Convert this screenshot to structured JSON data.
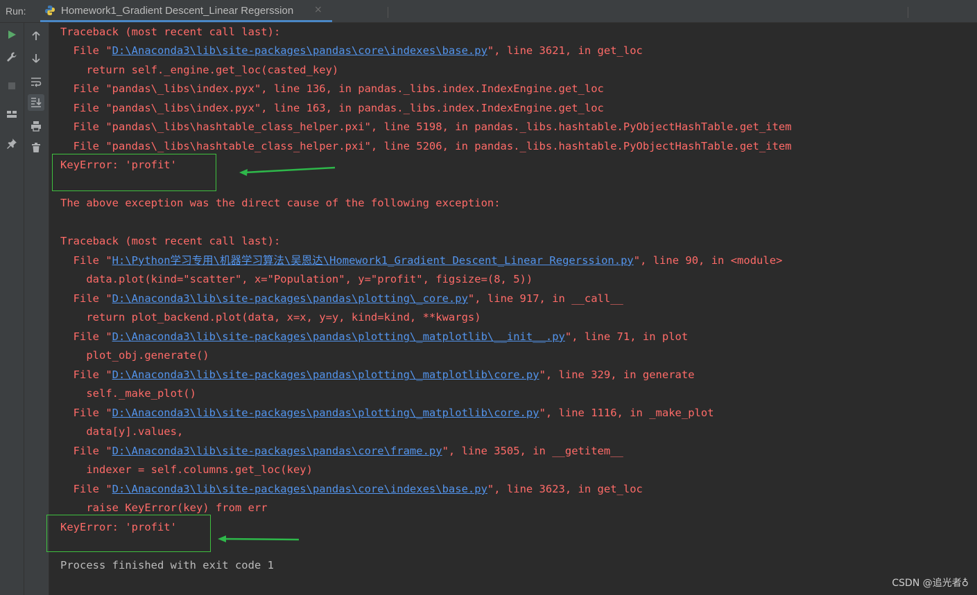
{
  "header": {
    "run_label": "Run:",
    "tab_title": "Homework1_Gradient Descent_Linear Regerssion",
    "close_glyph": "×"
  },
  "console": {
    "tb1": {
      "line": "Traceback (most recent call last):"
    },
    "f1": {
      "pre": "  File \"",
      "link": "D:\\Anaconda3\\lib\\site-packages\\pandas\\core\\indexes\\base.py",
      "post": "\", line 3621, in get_loc"
    },
    "c1": "    return self._engine.get_loc(casted_key)",
    "f2": "  File \"pandas\\_libs\\index.pyx\", line 136, in pandas._libs.index.IndexEngine.get_loc",
    "f3": "  File \"pandas\\_libs\\index.pyx\", line 163, in pandas._libs.index.IndexEngine.get_loc",
    "f4": "  File \"pandas\\_libs\\hashtable_class_helper.pxi\", line 5198, in pandas._libs.hashtable.PyObjectHashTable.get_item",
    "f5": "  File \"pandas\\_libs\\hashtable_class_helper.pxi\", line 5206, in pandas._libs.hashtable.PyObjectHashTable.get_item",
    "err1": "KeyError: 'profit'",
    "cause": "The above exception was the direct cause of the following exception:",
    "tb2": {
      "line": "Traceback (most recent call last):"
    },
    "g1": {
      "pre": "  File \"",
      "link": "H:\\Python学习专用\\机器学习算法\\吴恩达\\Homework1_Gradient Descent_Linear Regerssion.py",
      "post": "\", line 90, in <module>"
    },
    "d1": "    data.plot(kind=\"scatter\", x=\"Population\", y=\"profit\", figsize=(8, 5))",
    "g2": {
      "pre": "  File \"",
      "link": "D:\\Anaconda3\\lib\\site-packages\\pandas\\plotting\\_core.py",
      "post": "\", line 917, in __call__"
    },
    "d2": "    return plot_backend.plot(data, x=x, y=y, kind=kind, **kwargs)",
    "g3": {
      "pre": "  File \"",
      "link": "D:\\Anaconda3\\lib\\site-packages\\pandas\\plotting\\_matplotlib\\__init__.py",
      "post": "\", line 71, in plot"
    },
    "d3": "    plot_obj.generate()",
    "g4": {
      "pre": "  File \"",
      "link": "D:\\Anaconda3\\lib\\site-packages\\pandas\\plotting\\_matplotlib\\core.py",
      "post": "\", line 329, in generate"
    },
    "d4": "    self._make_plot()",
    "g5": {
      "pre": "  File \"",
      "link": "D:\\Anaconda3\\lib\\site-packages\\pandas\\plotting\\_matplotlib\\core.py",
      "post": "\", line 1116, in _make_plot"
    },
    "d5": "    data[y].values,",
    "g6": {
      "pre": "  File \"",
      "link": "D:\\Anaconda3\\lib\\site-packages\\pandas\\core\\frame.py",
      "post": "\", line 3505, in __getitem__"
    },
    "d6": "    indexer = self.columns.get_loc(key)",
    "g7": {
      "pre": "  File \"",
      "link": "D:\\Anaconda3\\lib\\site-packages\\pandas\\core\\indexes\\base.py",
      "post": "\", line 3623, in get_loc"
    },
    "d7": "    raise KeyError(key) from err",
    "err2": "KeyError: 'profit'",
    "exit": "Process finished with exit code 1"
  },
  "watermark": "CSDN @追光者♁",
  "colors": {
    "error_text": "#ff6b68",
    "link": "#5394ec",
    "plain_text": "#bbbbbb",
    "highlight": "#3fc23f",
    "background": "#2b2b2b"
  }
}
